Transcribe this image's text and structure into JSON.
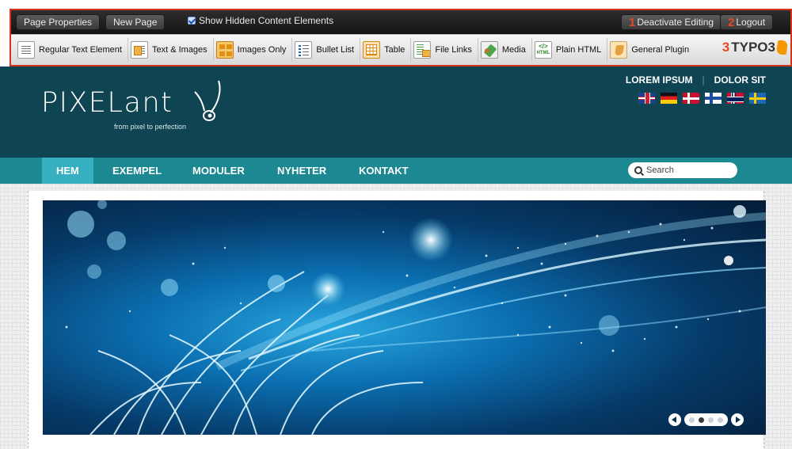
{
  "toolbar": {
    "page_properties": "Page Properties",
    "new_page": "New Page",
    "show_hidden": "Show Hidden Content Elements",
    "deactivate_num": "1",
    "deactivate": "Deactivate Editing",
    "logout_num": "2",
    "logout": "Logout",
    "elements": [
      {
        "label": "Regular Text Element",
        "icon": "text-element-icon"
      },
      {
        "label": "Text & Images",
        "icon": "text-images-icon"
      },
      {
        "label": "Images Only",
        "icon": "images-only-icon"
      },
      {
        "label": "Bullet List",
        "icon": "bullet-list-icon"
      },
      {
        "label": "Table",
        "icon": "table-icon"
      },
      {
        "label": "File Links",
        "icon": "file-links-icon"
      },
      {
        "label": "Media",
        "icon": "media-icon"
      },
      {
        "label": "Plain HTML",
        "icon": "html-icon"
      },
      {
        "label": "General Plugin",
        "icon": "plugin-icon"
      }
    ],
    "typo3_num": "3",
    "typo3": "TYPO3",
    "accent": "#d6341a"
  },
  "site": {
    "logo_text": "PIXELant",
    "logo_tagline": "from pixel to perfection",
    "top_link_1": "LOREM IPSUM",
    "top_link_2": "DOLOR SIT",
    "flags": [
      "uk-flag-icon",
      "germany-flag-icon",
      "denmark-flag-icon",
      "finland-flag-icon",
      "norway-flag-icon",
      "sweden-flag-icon"
    ],
    "header_color": "#0f4453",
    "nav_color": "#1c8892"
  },
  "nav": {
    "items": [
      "HEM",
      "EXEMPEL",
      "MODULER",
      "NYHETER",
      "KONTAKT"
    ],
    "active_index": 0
  },
  "search": {
    "placeholder": "Search"
  },
  "slider": {
    "dots": 4,
    "active_dot": 2
  }
}
